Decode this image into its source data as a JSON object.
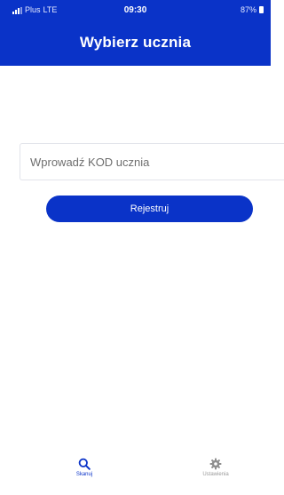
{
  "status_bar": {
    "carrier": "Plus",
    "network": "LTE",
    "time": "09:30",
    "battery": "87%"
  },
  "header": {
    "title": "Wybierz ucznia"
  },
  "form": {
    "code_placeholder": "Wprowadź KOD ucznia",
    "code_value": "",
    "register_label": "Rejestruj"
  },
  "tab_bar": {
    "items": [
      {
        "label": "Skanuj",
        "icon": "search-icon",
        "active": true
      },
      {
        "label": "Ustawienia",
        "icon": "gear-icon",
        "active": false
      }
    ]
  },
  "colors": {
    "primary": "#0a33c8",
    "inactive": "#9a9a9a"
  }
}
